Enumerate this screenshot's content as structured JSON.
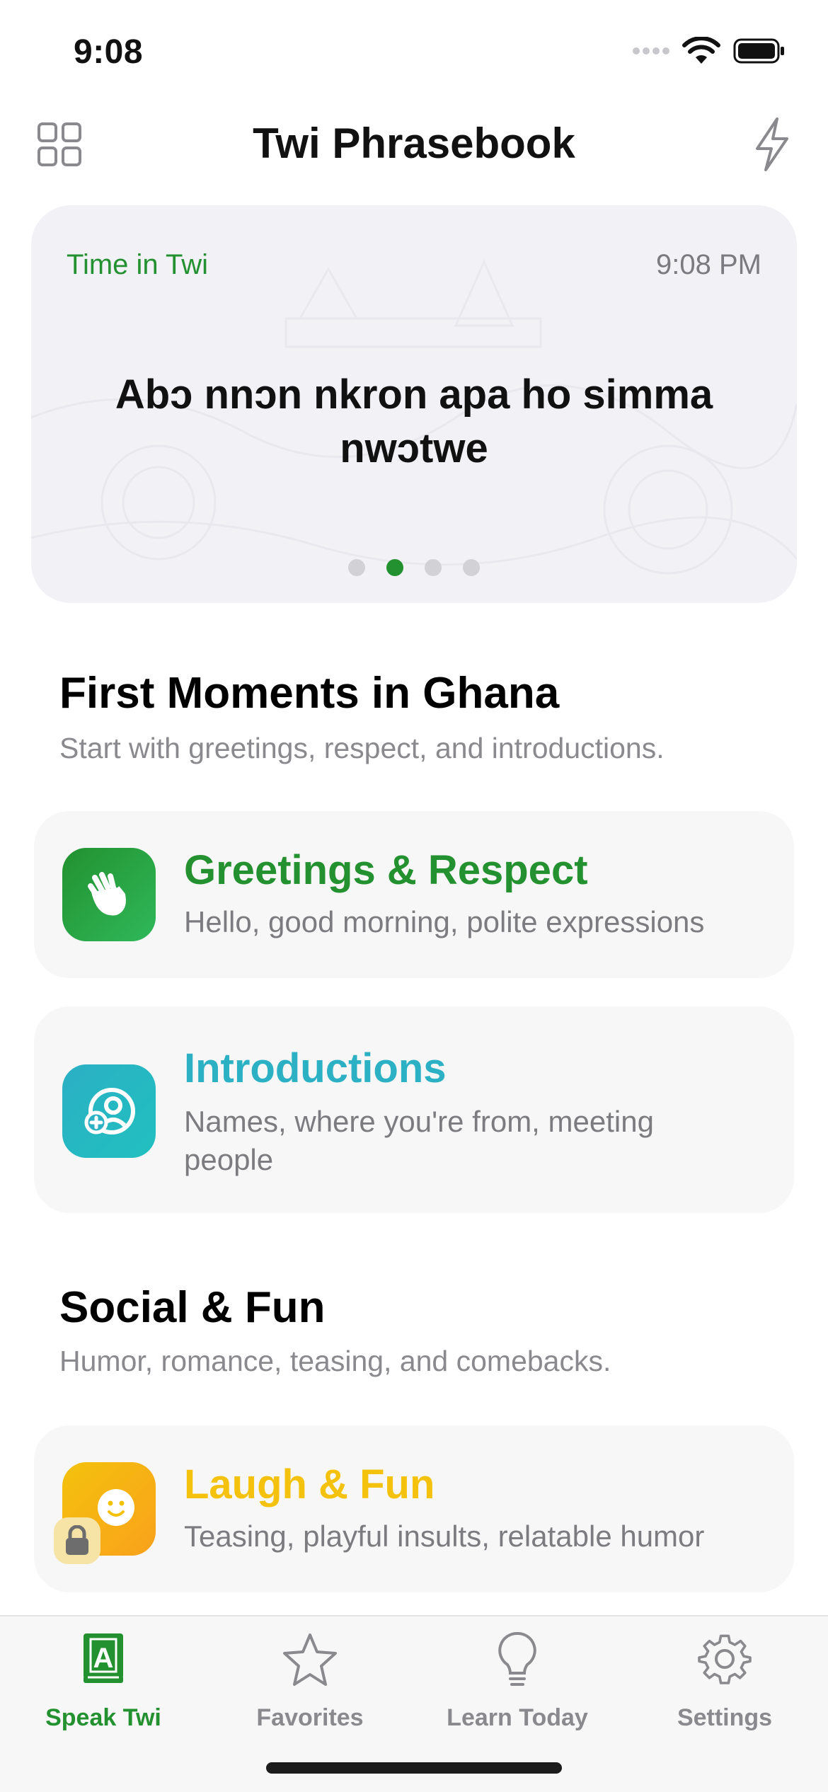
{
  "status_bar": {
    "time": "9:08"
  },
  "header": {
    "title": "Twi Phrasebook",
    "left_icon": "grid-icon",
    "right_icon": "bolt-icon"
  },
  "hero": {
    "label": "Time in Twi",
    "time": "9:08 PM",
    "phrase": "Abɔ nnɔn nkron apa ho simma nwɔtwe",
    "page_count": 4,
    "active_page": 2
  },
  "sections": [
    {
      "title": "First Moments in Ghana",
      "subtitle": "Start with greetings, respect, and introductions.",
      "cards": [
        {
          "title": "Greetings & Respect",
          "description": "Hello, good morning, polite expressions",
          "color": "#23912f",
          "icon": "waving-hand-icon",
          "locked": false
        },
        {
          "title": "Introductions",
          "description": "Names, where you're from, meeting people",
          "color": "#2bb0c4",
          "icon": "add-person-icon",
          "locked": false
        }
      ]
    },
    {
      "title": "Social & Fun",
      "subtitle": "Humor, romance, teasing, and comebacks.",
      "cards": [
        {
          "title": "Laugh & Fun",
          "description": "Teasing, playful insults, relatable humor",
          "color": "#f4c20d",
          "icon": "smiley-icon",
          "locked": true
        }
      ]
    }
  ],
  "tabs": [
    {
      "label": "Speak Twi",
      "icon": "book-icon",
      "active": true
    },
    {
      "label": "Favorites",
      "icon": "star-icon",
      "active": false
    },
    {
      "label": "Learn Today",
      "icon": "lightbulb-icon",
      "active": false
    },
    {
      "label": "Settings",
      "icon": "gear-icon",
      "active": false
    }
  ],
  "colors": {
    "accent": "#23912f",
    "teal": "#2bb0c4",
    "yellow": "#f4c20d"
  }
}
